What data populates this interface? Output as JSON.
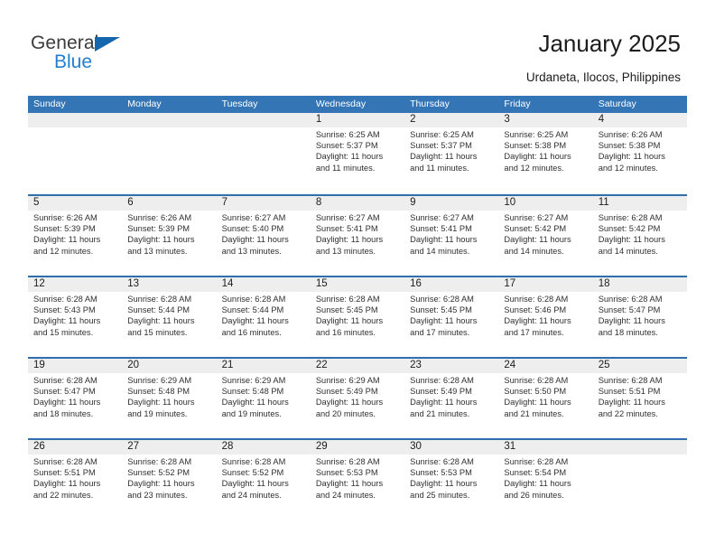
{
  "header": {
    "logo": {
      "word1": "General",
      "word2": "Blue",
      "triangle_color": "#1467ad",
      "word2_color": "#1f7fd0"
    },
    "title": "January 2025",
    "location": "Urdaneta, Ilocos, Philippines"
  },
  "calendar": {
    "header_bg": "#3476b5",
    "numbar_bg": "#eeeeee",
    "separator_color": "#2f6fae",
    "weekdays": [
      "Sunday",
      "Monday",
      "Tuesday",
      "Wednesday",
      "Thursday",
      "Friday",
      "Saturday"
    ],
    "weeks": [
      [
        {
          "day": "",
          "lines": []
        },
        {
          "day": "",
          "lines": []
        },
        {
          "day": "",
          "lines": []
        },
        {
          "day": "1",
          "lines": [
            "Sunrise: 6:25 AM",
            "Sunset: 5:37 PM",
            "Daylight: 11 hours",
            "and 11 minutes."
          ]
        },
        {
          "day": "2",
          "lines": [
            "Sunrise: 6:25 AM",
            "Sunset: 5:37 PM",
            "Daylight: 11 hours",
            "and 11 minutes."
          ]
        },
        {
          "day": "3",
          "lines": [
            "Sunrise: 6:25 AM",
            "Sunset: 5:38 PM",
            "Daylight: 11 hours",
            "and 12 minutes."
          ]
        },
        {
          "day": "4",
          "lines": [
            "Sunrise: 6:26 AM",
            "Sunset: 5:38 PM",
            "Daylight: 11 hours",
            "and 12 minutes."
          ]
        }
      ],
      [
        {
          "day": "5",
          "lines": [
            "Sunrise: 6:26 AM",
            "Sunset: 5:39 PM",
            "Daylight: 11 hours",
            "and 12 minutes."
          ]
        },
        {
          "day": "6",
          "lines": [
            "Sunrise: 6:26 AM",
            "Sunset: 5:39 PM",
            "Daylight: 11 hours",
            "and 13 minutes."
          ]
        },
        {
          "day": "7",
          "lines": [
            "Sunrise: 6:27 AM",
            "Sunset: 5:40 PM",
            "Daylight: 11 hours",
            "and 13 minutes."
          ]
        },
        {
          "day": "8",
          "lines": [
            "Sunrise: 6:27 AM",
            "Sunset: 5:41 PM",
            "Daylight: 11 hours",
            "and 13 minutes."
          ]
        },
        {
          "day": "9",
          "lines": [
            "Sunrise: 6:27 AM",
            "Sunset: 5:41 PM",
            "Daylight: 11 hours",
            "and 14 minutes."
          ]
        },
        {
          "day": "10",
          "lines": [
            "Sunrise: 6:27 AM",
            "Sunset: 5:42 PM",
            "Daylight: 11 hours",
            "and 14 minutes."
          ]
        },
        {
          "day": "11",
          "lines": [
            "Sunrise: 6:28 AM",
            "Sunset: 5:42 PM",
            "Daylight: 11 hours",
            "and 14 minutes."
          ]
        }
      ],
      [
        {
          "day": "12",
          "lines": [
            "Sunrise: 6:28 AM",
            "Sunset: 5:43 PM",
            "Daylight: 11 hours",
            "and 15 minutes."
          ]
        },
        {
          "day": "13",
          "lines": [
            "Sunrise: 6:28 AM",
            "Sunset: 5:44 PM",
            "Daylight: 11 hours",
            "and 15 minutes."
          ]
        },
        {
          "day": "14",
          "lines": [
            "Sunrise: 6:28 AM",
            "Sunset: 5:44 PM",
            "Daylight: 11 hours",
            "and 16 minutes."
          ]
        },
        {
          "day": "15",
          "lines": [
            "Sunrise: 6:28 AM",
            "Sunset: 5:45 PM",
            "Daylight: 11 hours",
            "and 16 minutes."
          ]
        },
        {
          "day": "16",
          "lines": [
            "Sunrise: 6:28 AM",
            "Sunset: 5:45 PM",
            "Daylight: 11 hours",
            "and 17 minutes."
          ]
        },
        {
          "day": "17",
          "lines": [
            "Sunrise: 6:28 AM",
            "Sunset: 5:46 PM",
            "Daylight: 11 hours",
            "and 17 minutes."
          ]
        },
        {
          "day": "18",
          "lines": [
            "Sunrise: 6:28 AM",
            "Sunset: 5:47 PM",
            "Daylight: 11 hours",
            "and 18 minutes."
          ]
        }
      ],
      [
        {
          "day": "19",
          "lines": [
            "Sunrise: 6:28 AM",
            "Sunset: 5:47 PM",
            "Daylight: 11 hours",
            "and 18 minutes."
          ]
        },
        {
          "day": "20",
          "lines": [
            "Sunrise: 6:29 AM",
            "Sunset: 5:48 PM",
            "Daylight: 11 hours",
            "and 19 minutes."
          ]
        },
        {
          "day": "21",
          "lines": [
            "Sunrise: 6:29 AM",
            "Sunset: 5:48 PM",
            "Daylight: 11 hours",
            "and 19 minutes."
          ]
        },
        {
          "day": "22",
          "lines": [
            "Sunrise: 6:29 AM",
            "Sunset: 5:49 PM",
            "Daylight: 11 hours",
            "and 20 minutes."
          ]
        },
        {
          "day": "23",
          "lines": [
            "Sunrise: 6:28 AM",
            "Sunset: 5:49 PM",
            "Daylight: 11 hours",
            "and 21 minutes."
          ]
        },
        {
          "day": "24",
          "lines": [
            "Sunrise: 6:28 AM",
            "Sunset: 5:50 PM",
            "Daylight: 11 hours",
            "and 21 minutes."
          ]
        },
        {
          "day": "25",
          "lines": [
            "Sunrise: 6:28 AM",
            "Sunset: 5:51 PM",
            "Daylight: 11 hours",
            "and 22 minutes."
          ]
        }
      ],
      [
        {
          "day": "26",
          "lines": [
            "Sunrise: 6:28 AM",
            "Sunset: 5:51 PM",
            "Daylight: 11 hours",
            "and 22 minutes."
          ]
        },
        {
          "day": "27",
          "lines": [
            "Sunrise: 6:28 AM",
            "Sunset: 5:52 PM",
            "Daylight: 11 hours",
            "and 23 minutes."
          ]
        },
        {
          "day": "28",
          "lines": [
            "Sunrise: 6:28 AM",
            "Sunset: 5:52 PM",
            "Daylight: 11 hours",
            "and 24 minutes."
          ]
        },
        {
          "day": "29",
          "lines": [
            "Sunrise: 6:28 AM",
            "Sunset: 5:53 PM",
            "Daylight: 11 hours",
            "and 24 minutes."
          ]
        },
        {
          "day": "30",
          "lines": [
            "Sunrise: 6:28 AM",
            "Sunset: 5:53 PM",
            "Daylight: 11 hours",
            "and 25 minutes."
          ]
        },
        {
          "day": "31",
          "lines": [
            "Sunrise: 6:28 AM",
            "Sunset: 5:54 PM",
            "Daylight: 11 hours",
            "and 26 minutes."
          ]
        },
        {
          "day": "",
          "lines": []
        }
      ]
    ]
  }
}
